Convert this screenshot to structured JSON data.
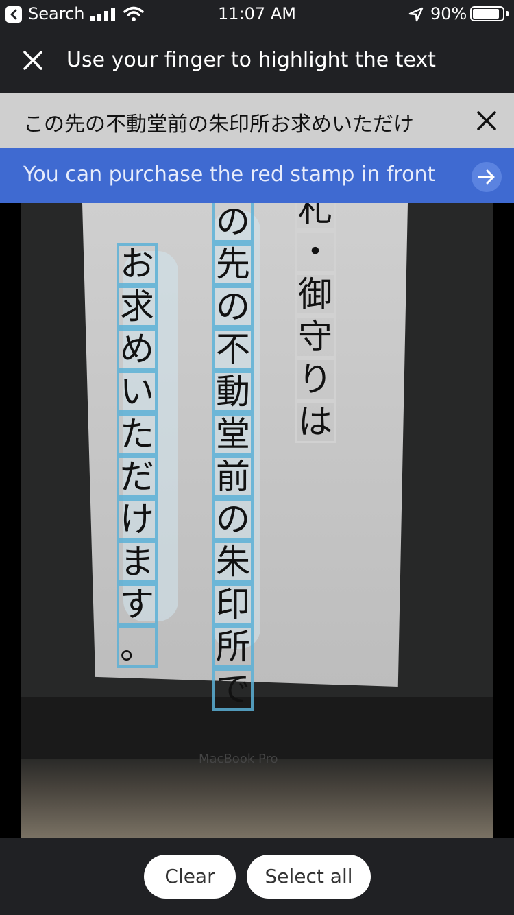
{
  "status_bar": {
    "back_app": "Search",
    "time": "11:07 AM",
    "battery": "90%",
    "battery_level": 0.9
  },
  "header": {
    "title": "Use your finger to highlight the text"
  },
  "source": {
    "text": "この先の不動堂前の朱印所お求めいただけ"
  },
  "translation": {
    "text": "You can purchase the red stamp in front o"
  },
  "camera": {
    "columns": [
      {
        "chars": [
          "札",
          "・",
          "御",
          "守",
          "り",
          "は"
        ]
      },
      {
        "chars": [
          "の",
          "先",
          "の",
          "不",
          "動",
          "堂",
          "前",
          "の",
          "朱",
          "印",
          "所",
          "で"
        ]
      },
      {
        "chars": [
          "お",
          "求",
          "め",
          "い",
          "た",
          "だ",
          "け",
          "ま",
          "す",
          "。"
        ]
      }
    ],
    "brand": "MacBook Pro"
  },
  "bottom": {
    "clear_label": "Clear",
    "select_all_label": "Select all"
  }
}
